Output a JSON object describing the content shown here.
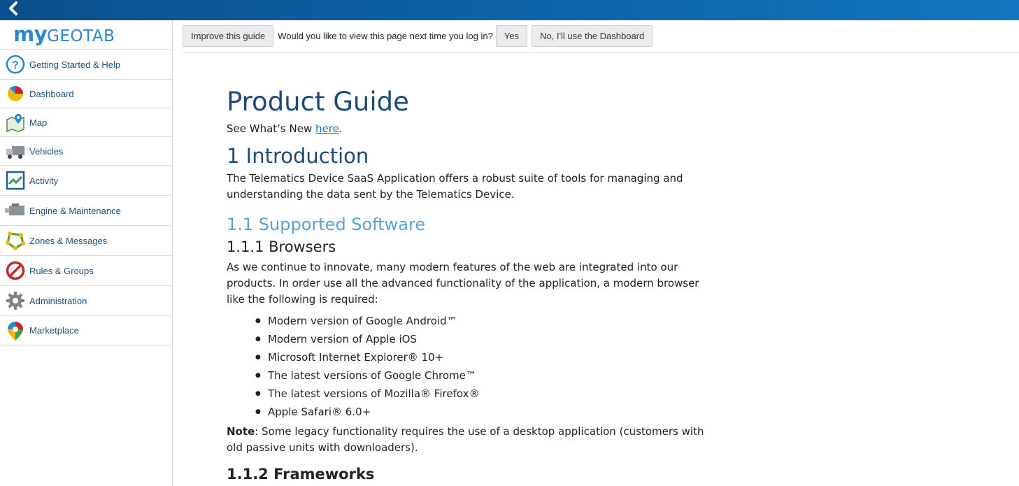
{
  "logo": {
    "my": "my",
    "geo": "GEOTAB"
  },
  "sidebar": {
    "items": [
      {
        "label": "Getting Started & Help",
        "icon": "help-icon"
      },
      {
        "label": "Dashboard",
        "icon": "dashboard-pie-icon"
      },
      {
        "label": "Map",
        "icon": "map-icon"
      },
      {
        "label": "Vehicles",
        "icon": "truck-icon"
      },
      {
        "label": "Activity",
        "icon": "activity-chart-icon"
      },
      {
        "label": "Engine & Maintenance",
        "icon": "engine-icon"
      },
      {
        "label": "Zones & Messages",
        "icon": "zones-icon"
      },
      {
        "label": "Rules & Groups",
        "icon": "rules-icon"
      },
      {
        "label": "Administration",
        "icon": "gear-icon"
      },
      {
        "label": "Marketplace",
        "icon": "marketplace-icon"
      }
    ]
  },
  "toolbar": {
    "improve_label": "Improve this guide",
    "prompt": "Would you like to view this page next time you log in?",
    "yes_label": "Yes",
    "no_label": "No, I'll use the Dashboard"
  },
  "guide": {
    "title": "Product Guide",
    "whatsnew_prefix": "See What’s New ",
    "whatsnew_link": "here",
    "whatsnew_suffix": ".",
    "intro_heading": "1 Introduction",
    "intro_text": "The Telematics Device SaaS Application offers a robust suite of tools for managing and understanding the data sent by the Telematics Device.",
    "supported_heading": "1.1 Supported Software",
    "browsers_heading": "1.1.1 Browsers",
    "browsers_text": "As we continue to innovate, many modern features of the web are integrated into our products. In order use all the advanced functionality of the application, a modern browser like the following is required:",
    "browser_list": [
      "Modern version of Google Android™",
      "Modern version of Apple iOS",
      "Microsoft Internet Explorer® 10+",
      "The latest versions of Google Chrome™",
      "The latest versions of Mozilla® Firefox®",
      "Apple Safari® 6.0+"
    ],
    "note_label": "Note",
    "note_text": ": Some legacy functionality requires the use of a desktop application (customers with old passive units with downloaders).",
    "next_heading": "1.1.2 Frameworks"
  }
}
